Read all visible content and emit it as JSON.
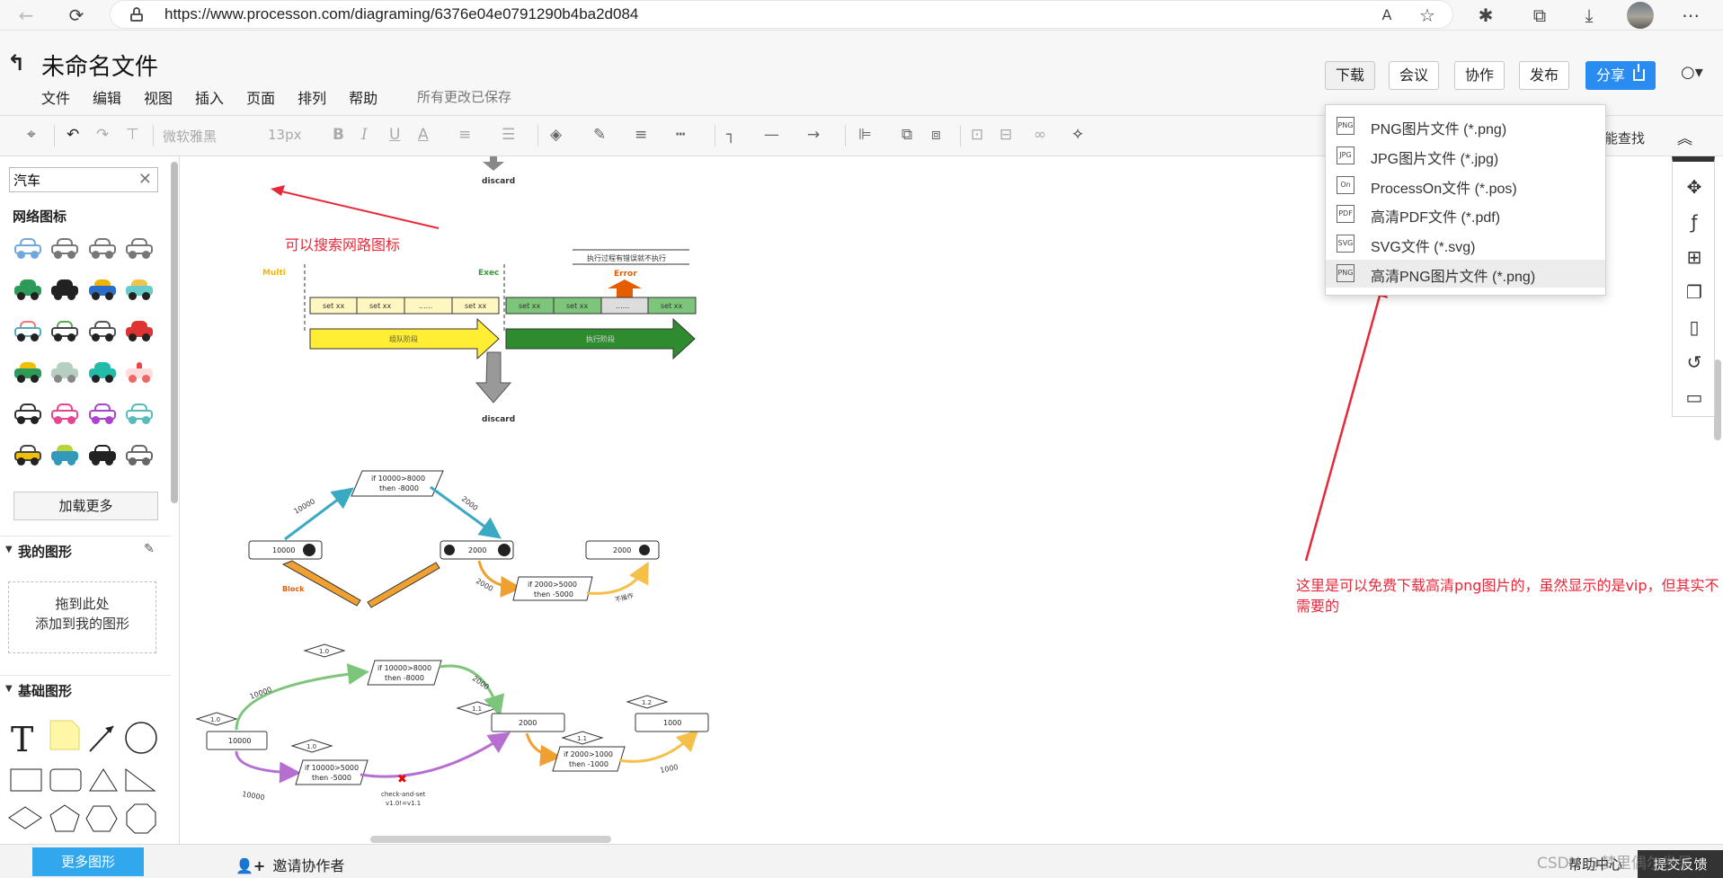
{
  "browser": {
    "url": "https://www.processon.com/diagraming/6376e04e0791290b4ba2d084"
  },
  "header": {
    "title": "未命名文件",
    "menu": [
      "文件",
      "编辑",
      "视图",
      "插入",
      "页面",
      "排列",
      "帮助"
    ],
    "save_status": "所有更改已保存",
    "buttons": {
      "download": "下载",
      "meeting": "会议",
      "collab": "协作",
      "publish": "发布",
      "share": "分享"
    }
  },
  "toolbar": {
    "font": "微软雅黑",
    "size": "13px",
    "find_label": "能查找"
  },
  "sidebar": {
    "search_value": "汽车",
    "section_network": "网络图标",
    "load_more": "加载更多",
    "my_shapes": "我的图形",
    "drop_hint_1": "拖到此处",
    "drop_hint_2": "添加到我的图形",
    "basic_shapes": "基础图形",
    "more_shapes": "更多图形"
  },
  "download_menu": {
    "items": [
      {
        "label": "PNG图片文件 (*.png)",
        "icon": "PNG"
      },
      {
        "label": "JPG图片文件 (*.jpg)",
        "icon": "JPG"
      },
      {
        "label": "ProcessOn文件 (*.pos)",
        "icon": "On"
      },
      {
        "label": "高清PDF文件 (*.pdf)",
        "icon": "PDF"
      },
      {
        "label": "SVG文件 (*.svg)",
        "icon": "SVG"
      },
      {
        "label": "高清PNG图片文件 (*.png)",
        "icon": "PNG"
      }
    ]
  },
  "annotations": {
    "search_hint": "可以搜索网路图标",
    "download_hint": "这里是可以免费下载高清png图片的，虽然显示的是vip，但其实不需要的"
  },
  "diagram": {
    "discard_top": "discard",
    "discard": "discard",
    "multi": "Multi",
    "exec": "Exec",
    "error": "Error",
    "error_note": "执行过程有错误就不执行",
    "queue_cells": [
      "set xx",
      "set xx",
      "......",
      "set xx"
    ],
    "exec_cells": [
      "set xx",
      "set xx",
      "......",
      "set xx"
    ],
    "queue_label": "组队阶段",
    "exec_label": "执行阶段",
    "d2_cond1": [
      "if 10000>8000",
      "then -8000"
    ],
    "d2_edge1": "10000",
    "d2_edge2": "2000",
    "d2_box1": "10000",
    "d2_box2": "2000",
    "d2_box3": "2000",
    "d2_block": "Block",
    "d2_edge3": "2000",
    "d2_cond2": [
      "if 2000>5000",
      "then -5000"
    ],
    "d2_noop": "不操作",
    "d3_v10a": "1.0",
    "d3_v10b": "1.0",
    "d3_v10c": "1.0",
    "d3_v11a": "1.1",
    "d3_v11b": "1.1",
    "d3_v12": "1.2",
    "d3_cond1": [
      "if 10000>8000",
      "then -8000"
    ],
    "d3_cond2": [
      "if 10000>5000",
      "then -5000"
    ],
    "d3_cond3": [
      "if 2000>1000",
      "then -1000"
    ],
    "d3_box1": "10000",
    "d3_box2": "2000",
    "d3_box3": "1000",
    "d3_e1": "10000",
    "d3_e2": "2000",
    "d3_e3": "10000",
    "d3_e4": "1000",
    "d3_cas": [
      "check-and-set",
      "v1.0!=v1.1"
    ]
  },
  "bottom": {
    "invite": "邀请协作者",
    "help": "帮助中心",
    "feedback": "提交反馈",
    "watermark": "CSDN @梦里偶尔发呆"
  },
  "colors": {
    "accent": "#2a8cf0",
    "annotation_red": "#e8283a",
    "more_shapes_blue": "#31a7ee"
  }
}
